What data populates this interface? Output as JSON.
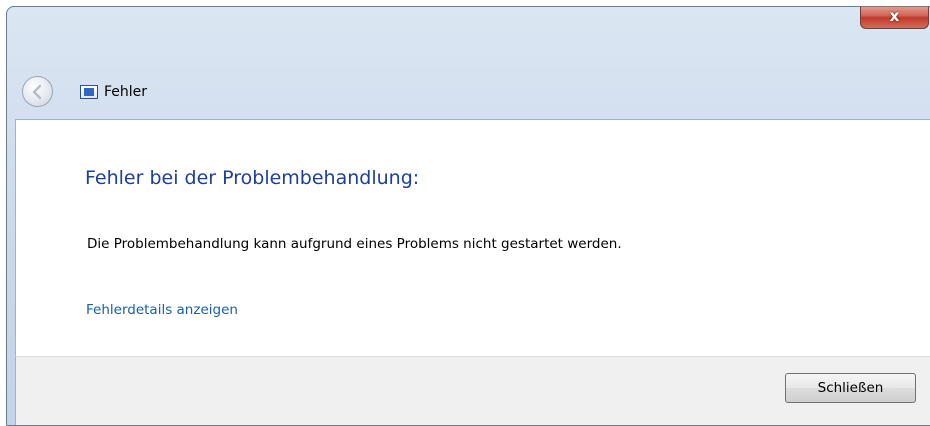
{
  "window": {
    "title": "Fehler",
    "close_glyph": "x"
  },
  "content": {
    "heading": "Fehler bei der Problembehandlung:",
    "message": "Die Problembehandlung kann aufgrund eines Problems nicht gestartet werden.",
    "details_link": "Fehlerdetails anzeigen"
  },
  "footer": {
    "close_button_label": "Schließen"
  },
  "icons": {
    "back": "back-arrow-icon",
    "app": "troubleshooter-icon",
    "close": "close-icon"
  },
  "colors": {
    "heading": "#1e3e9e",
    "link": "#1a5fa8",
    "close_accent": "#c0392b"
  }
}
